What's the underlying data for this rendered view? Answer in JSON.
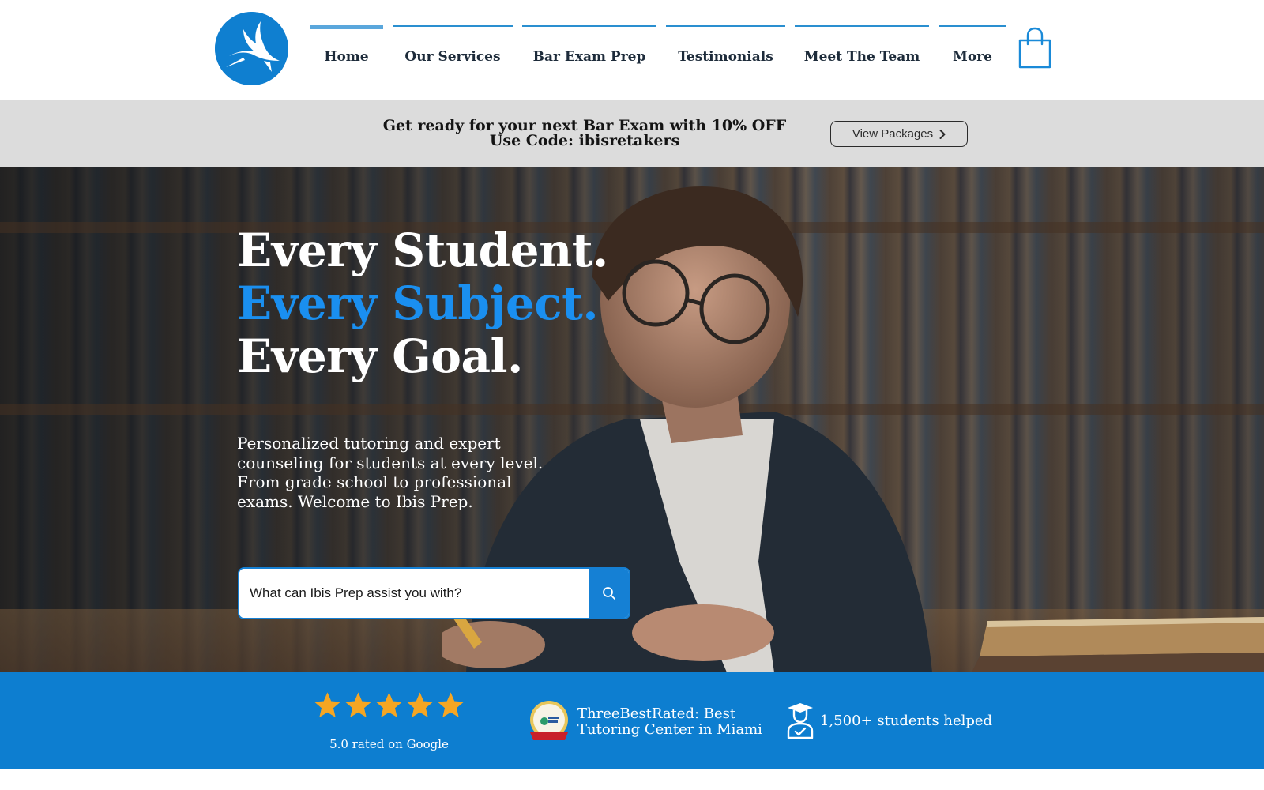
{
  "header": {
    "logo_icon": "ibis-bird-logo",
    "nav": [
      {
        "label": "Home",
        "active": true
      },
      {
        "label": "Our Services",
        "active": false
      },
      {
        "label": "Bar Exam Prep",
        "active": false
      },
      {
        "label": "Testimonials",
        "active": false
      },
      {
        "label": "Meet The Team",
        "active": false
      },
      {
        "label": "More",
        "active": false
      }
    ],
    "cart_icon": "shopping-bag-icon"
  },
  "promo": {
    "line1": "Get ready for your next Bar Exam with 10% OFF",
    "line2": "Use Code: ibisretakers",
    "button_label": "View Packages",
    "button_icon": "chevron-right-icon"
  },
  "hero": {
    "headline_line1": "Every Student.",
    "headline_line2": "Every Subject.",
    "headline_line3": "Every Goal.",
    "subtext": "Personalized tutoring and expert counseling for students at every level. From grade school to professional exams. Welcome to Ibis Prep.",
    "search_placeholder": "What can Ibis Prep assist you with?",
    "search_icon": "search-icon"
  },
  "trust_band": {
    "stars_count": 5,
    "rating_label": "5.0 rated on Google",
    "badge_icon": "threebestrated-badge",
    "badge_text_line1": "ThreeBestRated: Best",
    "badge_text_line2": "Tutoring Center in Miami",
    "students_icon": "graduate-icon",
    "students_text": "1,500+ students helped"
  },
  "colors": {
    "brand_blue": "#0f7fd0",
    "accent_blue": "#1a8ff0",
    "promo_bg": "#dcdcdc",
    "star_gold": "#f5a623"
  }
}
